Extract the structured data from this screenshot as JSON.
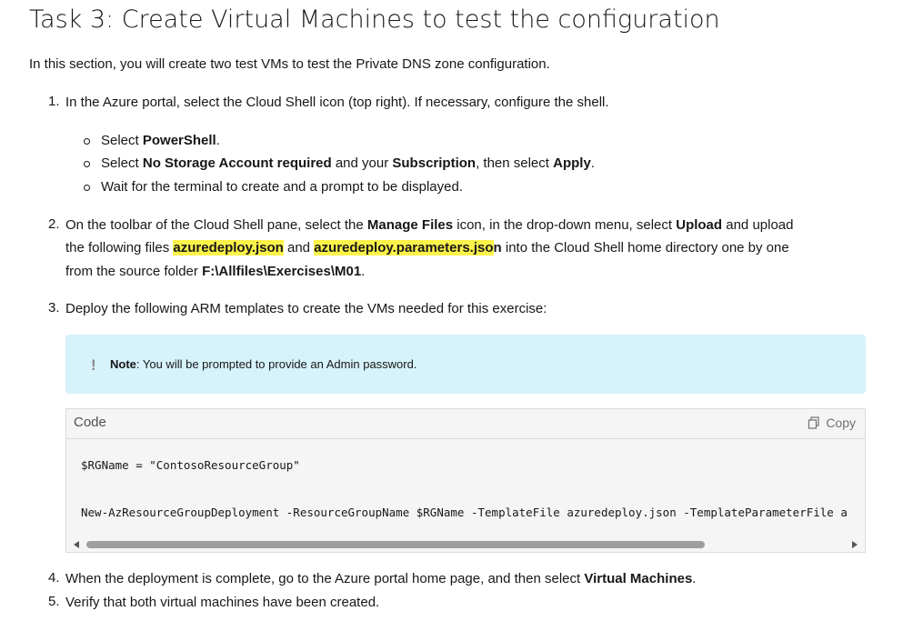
{
  "title": "Task 3: Create Virtual Machines to test the configuration",
  "intro": "In this section, you will create two test VMs to test the Private DNS zone configuration.",
  "steps": {
    "s1": {
      "num": "1.",
      "text": "In the Azure portal, select the Cloud Shell icon (top right). If necessary, configure the shell."
    },
    "s1_sub": {
      "a_pre": "Select ",
      "a_b1": "PowerShell",
      "a_post": ".",
      "b_pre": "Select ",
      "b_b1": "No Storage Account required",
      "b_mid": " and your ",
      "b_b2": "Subscription",
      "b_mid2": ", then select ",
      "b_b3": "Apply",
      "b_post": ".",
      "c": "Wait for the terminal to create and a prompt to be displayed."
    },
    "s2": {
      "num": "2.",
      "l1_pre": "On the toolbar of the Cloud Shell pane, select the ",
      "l1_b1": "Manage Files",
      "l1_mid": " icon, in the drop-down menu, select ",
      "l1_b2": "Upload",
      "l1_post": " and upload",
      "l2_pre": "the following files ",
      "l2_h1": "azuredeploy.json",
      "l2_mid": " and ",
      "l2_h2": "azuredeploy.parameters.jso",
      "l2_h2b": "n",
      "l2_post": " into the Cloud Shell home directory one by one",
      "l3_pre": "from the source folder ",
      "l3_b1": "F:\\Allfiles\\Exercises\\M01",
      "l3_post": "."
    },
    "s3": {
      "num": "3.",
      "text": "Deploy the following ARM templates to create the VMs needed for this exercise:"
    },
    "s4": {
      "num": "4.",
      "pre": "When the deployment is complete, go to the Azure portal home page, and then select ",
      "b1": "Virtual Machines",
      "post": "."
    },
    "s5": {
      "num": "5.",
      "text": "Verify that both virtual machines have been created."
    }
  },
  "note": {
    "icon": "!",
    "label": "Note",
    "text": ": You will be prompted to provide an Admin password."
  },
  "code": {
    "label": "Code",
    "copy_label": "Copy",
    "line1": "$RGName = \"ContosoResourceGroup\"",
    "line2": "New-AzResourceGroupDeployment -ResourceGroupName $RGName -TemplateFile azuredeploy.json -TemplateParameterFile a"
  },
  "colors": {
    "note_bg": "#d6f2fb",
    "highlight": "#fcf34a"
  }
}
